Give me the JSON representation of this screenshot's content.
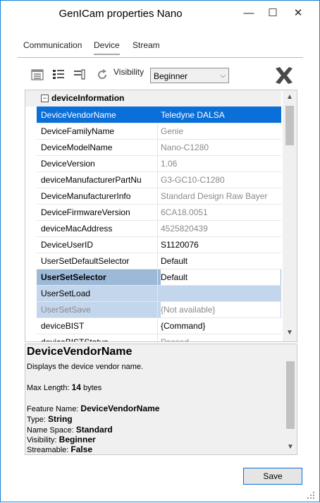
{
  "window": {
    "title": "GenICam properties Nano",
    "minimize_glyph": "—",
    "maximize_glyph": "☐",
    "close_glyph": "✕"
  },
  "tabs": [
    {
      "label": "Communication",
      "active": false
    },
    {
      "label": "Device",
      "active": true
    },
    {
      "label": "Stream",
      "active": false
    }
  ],
  "toolbar": {
    "icons": [
      "categorized-view-icon",
      "alphabetical-view-icon",
      "property-pages-icon",
      "refresh-icon"
    ],
    "visibility_label": "Visibility",
    "visibility_value": "Beginner",
    "logo_icon": "teledyne-x-logo"
  },
  "grid": {
    "category": {
      "label": "deviceInformation",
      "collapse_glyph": "−"
    },
    "rows": [
      {
        "name": "DeviceVendorName",
        "value": "Teledyne DALSA",
        "state": "selected"
      },
      {
        "name": "DeviceFamilyName",
        "value": "Genie",
        "state": "readonly"
      },
      {
        "name": "DeviceModelName",
        "value": "Nano-C1280",
        "state": "readonly"
      },
      {
        "name": "DeviceVersion",
        "value": "1.06",
        "state": "readonly"
      },
      {
        "name": "deviceManufacturerPartNu",
        "value": "G3-GC10-C1280",
        "state": "readonly"
      },
      {
        "name": "DeviceManufacturerInfo",
        "value": "Standard Design Raw Bayer",
        "state": "readonly"
      },
      {
        "name": "DeviceFirmwareVersion",
        "value": "6CA18.0051",
        "state": "readonly"
      },
      {
        "name": "deviceMacAddress",
        "value": "4525820439",
        "state": "readonly"
      },
      {
        "name": "DeviceUserID",
        "value": "S1120076",
        "state": "normal"
      },
      {
        "name": "UserSetDefaultSelector",
        "value": "Default",
        "state": "normal"
      },
      {
        "name": "UserSetSelector",
        "value": "Default",
        "state": "bold"
      },
      {
        "name": "UserSetLoad",
        "value": "",
        "state": "light"
      },
      {
        "name": "UserSetSave",
        "value": "{Not available}",
        "state": "light-disabled"
      },
      {
        "name": "deviceBIST",
        "value": "{Command}",
        "state": "normal"
      },
      {
        "name": "deviceBISTStatus",
        "value": "Passed",
        "state": "readonly"
      }
    ]
  },
  "description": {
    "title": "DeviceVendorName",
    "text": "Displays the device vendor name.",
    "max_length_label": "Max Length: ",
    "max_length_value": "14",
    "max_length_unit": " bytes",
    "feature_name_label": "Feature Name: ",
    "feature_name_value": "DeviceVendorName",
    "type_label": "Type: ",
    "type_value": "String",
    "namespace_label": "Name Space: ",
    "namespace_value": "Standard",
    "visibility_label": "Visibility: ",
    "visibility_value": "Beginner",
    "streamable_label": "Streamable: ",
    "streamable_value": "False"
  },
  "footer": {
    "save_label": "Save"
  },
  "colors": {
    "selected_row": "#0a6fd8",
    "bold_row": "#9db9d8",
    "light_row": "#c3d6ec",
    "window_border": "#1883d7"
  }
}
